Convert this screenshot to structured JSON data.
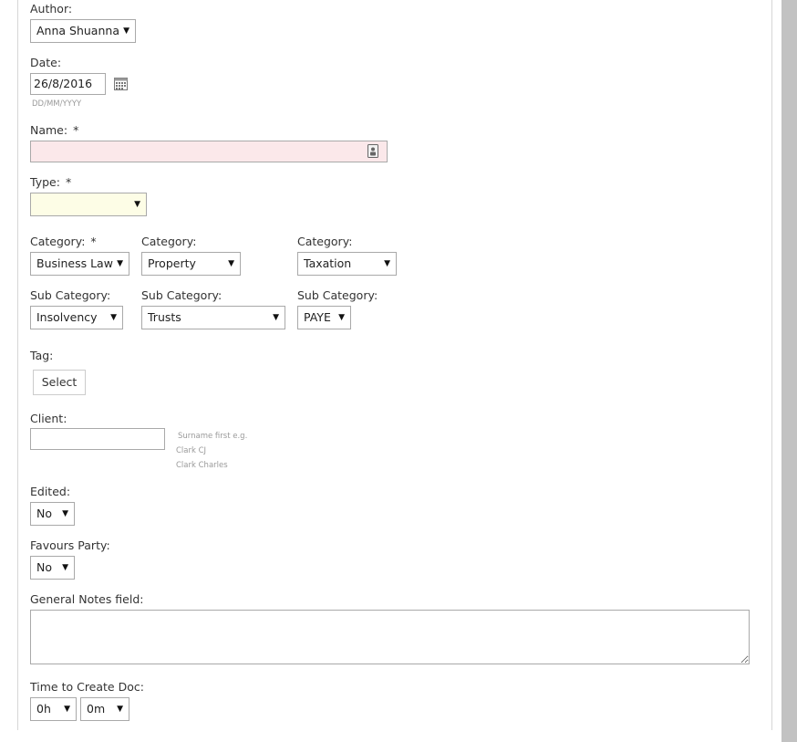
{
  "form": {
    "author": {
      "label": "Author:",
      "value": "Anna Shuanna"
    },
    "date": {
      "label": "Date:",
      "value": "26/8/2016",
      "format_hint": "DD/MM/YYYY"
    },
    "name": {
      "label": "Name:",
      "required_mark": "*",
      "value": ""
    },
    "type": {
      "label": "Type:",
      "required_mark": "*",
      "value": ""
    },
    "categories": [
      {
        "label": "Category:",
        "required_mark": "*",
        "value": "Business Law"
      },
      {
        "label": "Category:",
        "value": "Property"
      },
      {
        "label": "Category:",
        "value": "Taxation"
      }
    ],
    "sub_categories": [
      {
        "label": "Sub Category:",
        "value": "Insolvency"
      },
      {
        "label": "Sub Category:",
        "value": "Trusts"
      },
      {
        "label": "Sub Category:",
        "value": "PAYE"
      }
    ],
    "tag": {
      "label": "Tag:",
      "button_label": "Select"
    },
    "client": {
      "label": "Client:",
      "value": "",
      "hint_lines": [
        "Surname first e.g.",
        "Clark CJ",
        "Clark Charles"
      ]
    },
    "edited": {
      "label": "Edited:",
      "value": "No"
    },
    "favours_party": {
      "label": "Favours Party:",
      "value": "No"
    },
    "general_notes": {
      "label": "General Notes field:",
      "value": ""
    },
    "time_to_create": {
      "label": "Time to Create Doc:",
      "hours": "0h",
      "minutes": "0m"
    }
  },
  "colors": {
    "required_field_bg": "#fbe8ea",
    "highlight_field_bg": "#fdfde6",
    "scrollbar": "#c2c2c2"
  },
  "icons": {
    "calendar": "calendar-icon",
    "contact": "contact-card-icon",
    "dropdown": "triangle-down"
  }
}
